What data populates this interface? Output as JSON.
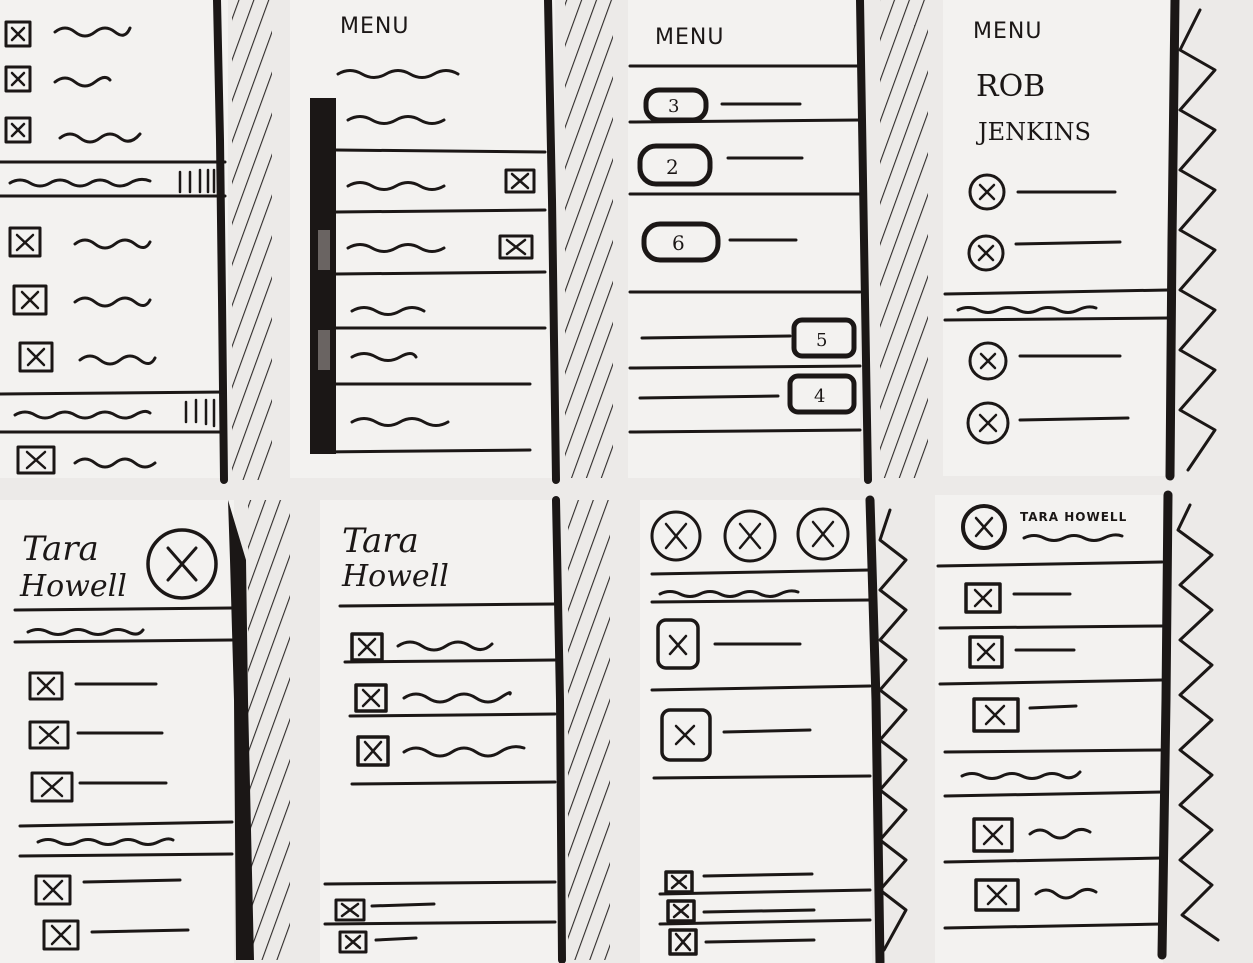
{
  "sketches": [
    {
      "id": 1,
      "menu_label": ""
    },
    {
      "id": 2,
      "menu_label": "MENU"
    },
    {
      "id": 3,
      "menu_label": "MENU",
      "badges": [
        "3",
        "2",
        "6",
        "5",
        "4"
      ]
    },
    {
      "id": 4,
      "menu_label": "MENU",
      "name_first": "ROB",
      "name_last": "JENKINS"
    },
    {
      "id": 5,
      "name_first": "Tara",
      "name_last": "Howell"
    },
    {
      "id": 6,
      "name_first": "Tara",
      "name_last": "Howell"
    },
    {
      "id": 7
    },
    {
      "id": 8,
      "name_full": "TARA HOWELL"
    }
  ],
  "colors": {
    "paper": "#eceae8",
    "ink": "#1b1716"
  }
}
